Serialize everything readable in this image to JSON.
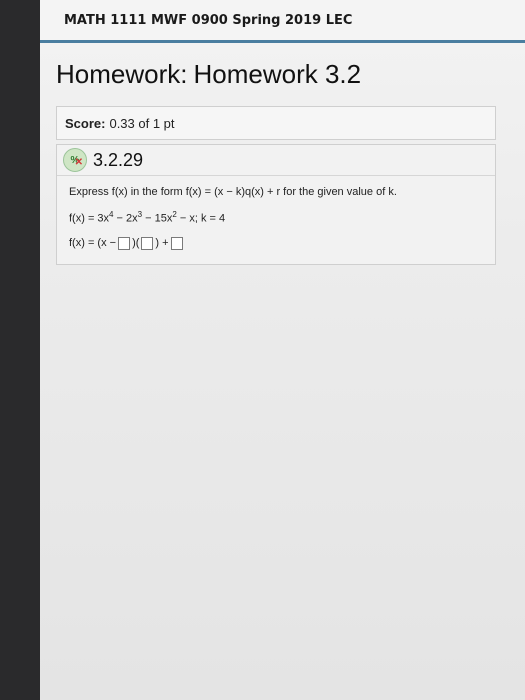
{
  "course": {
    "title": "MATH 1111 MWF 0900 Spring 2019 LEC"
  },
  "homework": {
    "title_prefix": "Homework:",
    "title_name": "Homework 3.2"
  },
  "score": {
    "label": "Score:",
    "value": "0.33 of 1 pt"
  },
  "question": {
    "status_icon": "partial-credit-icon",
    "number": "3.2.29",
    "prompt_a": "Express f(x) in the form",
    "prompt_form": "f(x) = (x − k)q(x) + r",
    "prompt_b": "for the given value of k.",
    "function_text": "f(x) = 3x",
    "exp4": "4",
    "term2": " − 2x",
    "exp3": "3",
    "term3": " − 15x",
    "exp2": "2",
    "term4": " − x; k = 4",
    "answer_lhs": "f(x) = (x −",
    "answer_mid": ")(",
    "answer_plus": ") +"
  }
}
